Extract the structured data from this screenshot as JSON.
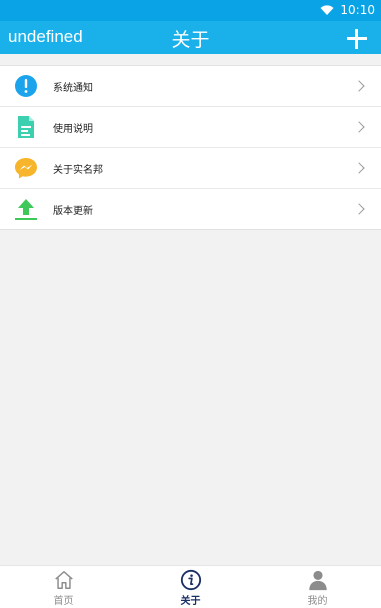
{
  "status_bar": {
    "time": "10:10"
  },
  "app_bar": {
    "left_text": "undefined",
    "title": "关于",
    "action_icon": "plus-icon"
  },
  "list": {
    "items": [
      {
        "label": "系统通知",
        "icon": "notice-icon"
      },
      {
        "label": "使用说明",
        "icon": "document-icon"
      },
      {
        "label": "关于实名邦",
        "icon": "messenger-icon"
      },
      {
        "label": "版本更新",
        "icon": "upload-icon"
      }
    ]
  },
  "tabs": [
    {
      "label": "首页",
      "icon": "home-icon",
      "active": false
    },
    {
      "label": "关于",
      "icon": "info-icon",
      "active": true
    },
    {
      "label": "我的",
      "icon": "person-icon",
      "active": false
    }
  ]
}
